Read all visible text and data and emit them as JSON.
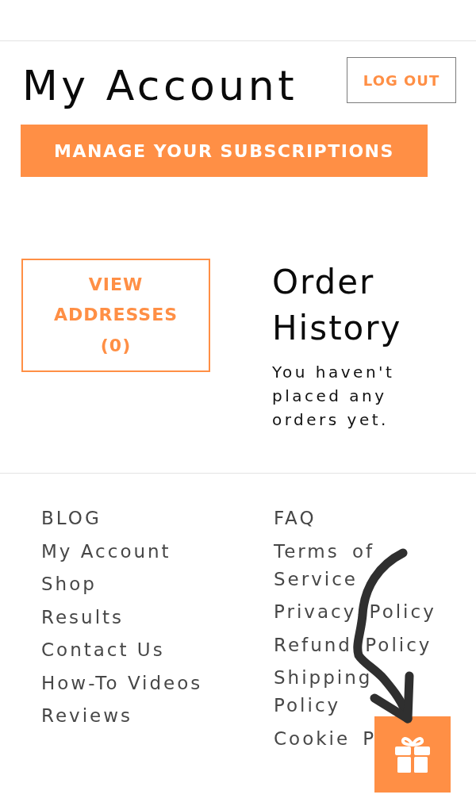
{
  "header": {
    "title": "My Account",
    "logout_button": "LOG OUT",
    "subscriptions_button": "MANAGE YOUR SUBSCRIPTIONS"
  },
  "addresses_button": "VIEW ADDRESSES (0)",
  "order_history": {
    "title": "Order History",
    "message": "You haven't placed any orders yet."
  },
  "footer": {
    "columns": [
      {
        "links": [
          "BLOG",
          "My Account",
          "Shop",
          "Results",
          "Contact Us",
          "How-To Videos",
          "Reviews"
        ]
      },
      {
        "links": [
          "FAQ",
          "Terms of Service",
          "Privacy Policy",
          "Refund Policy",
          "Shipping Policy",
          "Cookie P"
        ]
      }
    ]
  }
}
